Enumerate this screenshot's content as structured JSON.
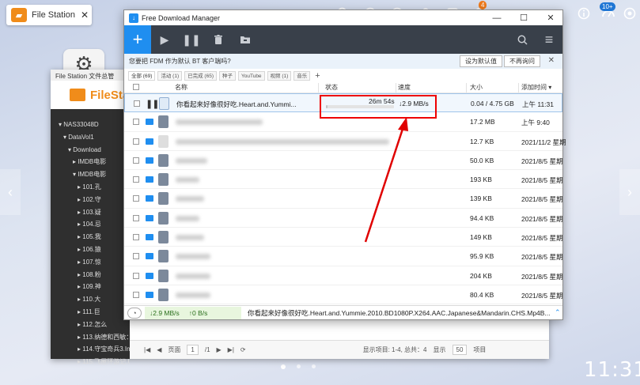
{
  "qts": {
    "tab_label": "File Station ...",
    "tab_close": "✕",
    "badge_count": "4",
    "badge_count_2": "10+",
    "clock": "11:31"
  },
  "file_station": {
    "title": "File Station 文件总管",
    "brand": "FileStation",
    "tree": [
      "▾ NAS33048D",
      "  ▾ DataVol1",
      "    ▾ Download",
      "      ▸ IMDB电影",
      "      ▾ IMDB电影",
      "        ▸ 101.孔",
      "        ▸ 102.守",
      "        ▸ 103.疑",
      "        ▸ 104.忌",
      "        ▸ 105.我",
      "        ▸ 106.猿",
      "        ▸ 107.惊",
      "        ▸ 108.粉",
      "        ▸ 109.神",
      "        ▸ 110.大",
      "        ▸ 111.巨",
      "        ▸ 112.怎么",
      "        ▸ 113.纳德和西敏：一",
      "        ▸ 114.守宝奇兵3.Indian",
      "        ▸ 115.飞屋环游记.Up.20"
    ],
    "pager": {
      "page_label": "页面",
      "page_value": "1",
      "page_total": "/1",
      "summary": "显示项目: 1-4, 总共：4",
      "per_page_label": "显示",
      "per_page_value": "50",
      "items_label": "项目"
    }
  },
  "fdm": {
    "title": "Free Download Manager",
    "window_controls": {
      "minimize": "—",
      "maximize": "☐",
      "close": "✕"
    },
    "toolbar": {
      "add": "+",
      "resume": "▶",
      "pause": "❚❚",
      "delete": "🗑",
      "move": "▤",
      "search": "⌕",
      "menu": "≡"
    },
    "notice": {
      "text": "您要把 FDM 作为默认 BT 客户端吗?",
      "set_default": "设为默认值",
      "dont_ask": "不再询问",
      "close": "✕"
    },
    "filters": [
      "全部 (69)",
      "活动 (1)",
      "已完成 (65)",
      "种子",
      "YouTube",
      "视频 (1)",
      "音乐"
    ],
    "filter_add": "+",
    "columns": {
      "name": "名称",
      "status": "状态",
      "speed": "速度",
      "size": "大小",
      "added": "添加时间 ▾"
    },
    "active_download": {
      "name": "你看起来好像很好吃.Heart.and.Yummi...",
      "time_left": "26m 54s",
      "progress_fraction": 0.01,
      "speed": "↓2.9 MB/s",
      "size": "0.04 / 4.75 GB",
      "added": "上午 11:31"
    },
    "rows": [
      {
        "size": "17.2 MB",
        "added": "上午 9:40",
        "icon": "file-dark"
      },
      {
        "size": "12.7 KB",
        "added": "2021/11/2 星期",
        "icon": "file-light"
      },
      {
        "size": "50.0 KB",
        "added": "2021/8/5 星期",
        "icon": "file-dark"
      },
      {
        "size": "193 KB",
        "added": "2021/8/5 星期",
        "icon": "file-dark"
      },
      {
        "size": "139 KB",
        "added": "2021/8/5 星期",
        "icon": "file-dark"
      },
      {
        "size": "94.4 KB",
        "added": "2021/8/5 星期",
        "icon": "file-dark"
      },
      {
        "size": "149 KB",
        "added": "2021/8/5 星期",
        "icon": "file-dark"
      },
      {
        "size": "95.9 KB",
        "added": "2021/8/5 星期",
        "icon": "file-dark"
      },
      {
        "size": "204 KB",
        "added": "2021/8/5 星期",
        "icon": "file-dark"
      },
      {
        "size": "80.4 KB",
        "added": "2021/8/5 星期",
        "icon": "file-dark"
      }
    ],
    "status_bar": {
      "down_speed": "↓2.9 MB/s",
      "up_speed": "↑0 B/s",
      "file": "你看起来好像很好吃.Heart.and.Yummie.2010.BD1080P.X264.AAC.Japanese&Mandarin.CHS.Mp4B...",
      "expand": "⌃"
    },
    "accent_color": "#1f8ef0",
    "annotation_color": "#e00000"
  }
}
